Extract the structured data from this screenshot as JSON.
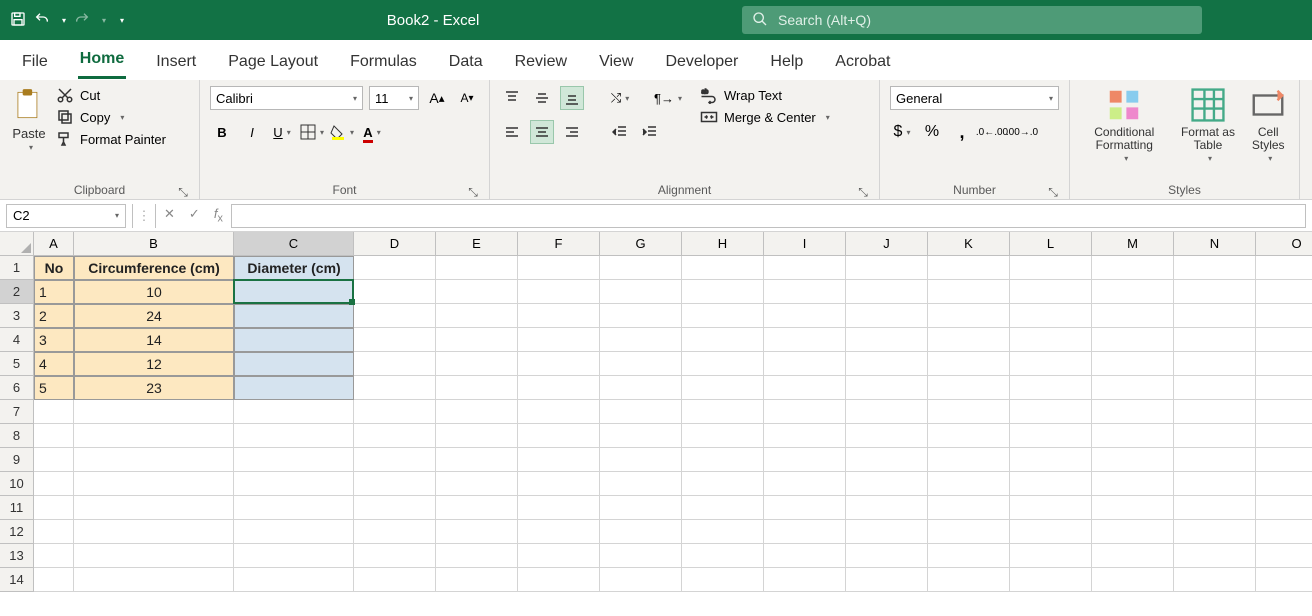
{
  "window": {
    "title": "Book2  -  Excel"
  },
  "search": {
    "placeholder": "Search (Alt+Q)"
  },
  "tabs": [
    "File",
    "Home",
    "Insert",
    "Page Layout",
    "Formulas",
    "Data",
    "Review",
    "View",
    "Developer",
    "Help",
    "Acrobat"
  ],
  "active_tab": "Home",
  "ribbon": {
    "clipboard": {
      "paste": "Paste",
      "cut": "Cut",
      "copy": "Copy",
      "fmt": "Format Painter",
      "label": "Clipboard"
    },
    "font": {
      "name": "Calibri",
      "size": "11",
      "label": "Font"
    },
    "alignment": {
      "wrap": "Wrap Text",
      "merge": "Merge & Center",
      "label": "Alignment"
    },
    "number": {
      "format": "General",
      "label": "Number"
    },
    "styles": {
      "cf": "Conditional Formatting",
      "fat": "Format as Table",
      "cs": "Cell Styles",
      "label": "Styles"
    }
  },
  "name_box": "C2",
  "formula": "",
  "columns": [
    "A",
    "B",
    "C",
    "D",
    "E",
    "F",
    "G",
    "H",
    "I",
    "J",
    "K",
    "L",
    "M",
    "N",
    "O"
  ],
  "col_widths": {
    "A": 40,
    "B": 160,
    "C": 120,
    "default": 82
  },
  "rows": 14,
  "selected_row": 2,
  "selected_col": "C",
  "sheet": {
    "A1": "No",
    "B1": "Circumference (cm)",
    "C1": "Diameter (cm)",
    "A2": "1",
    "B2": "10",
    "A3": "2",
    "B3": "24",
    "A4": "3",
    "B4": "14",
    "A5": "4",
    "B5": "12",
    "A6": "5",
    "B6": "23"
  }
}
